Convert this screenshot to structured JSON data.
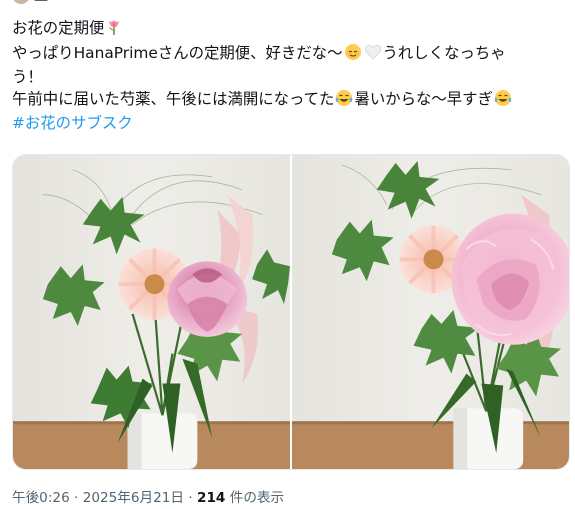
{
  "tweet": {
    "lines": [
      "お花の定期便",
      "やっぱりHanaPrimeさんの定期便、好きだな〜",
      "うれしくなっちゃ",
      "う！",
      "午前中に届いた芍薬、午後には満開になってた",
      "暑いからな〜早すぎ"
    ],
    "hashtag": "#お花のサブスク"
  },
  "emoji_icons": [
    "tulip-icon",
    "relieved-face-icon",
    "white-heart-icon",
    "tears-of-joy-icon"
  ],
  "media": {
    "photos": [
      {
        "name": "bouquet-photo-morning"
      },
      {
        "name": "bouquet-photo-afternoon"
      }
    ]
  },
  "meta": {
    "time": "午後0:26",
    "date": "2025年6月21日",
    "views": "214",
    "views_label": "件の表示"
  },
  "colors": {
    "text": "#0f1419",
    "secondary": "#536471",
    "link": "#1d9bf0",
    "wall": "#eceae5",
    "table": "#b48a5e",
    "peony": "#e9a6c0"
  }
}
